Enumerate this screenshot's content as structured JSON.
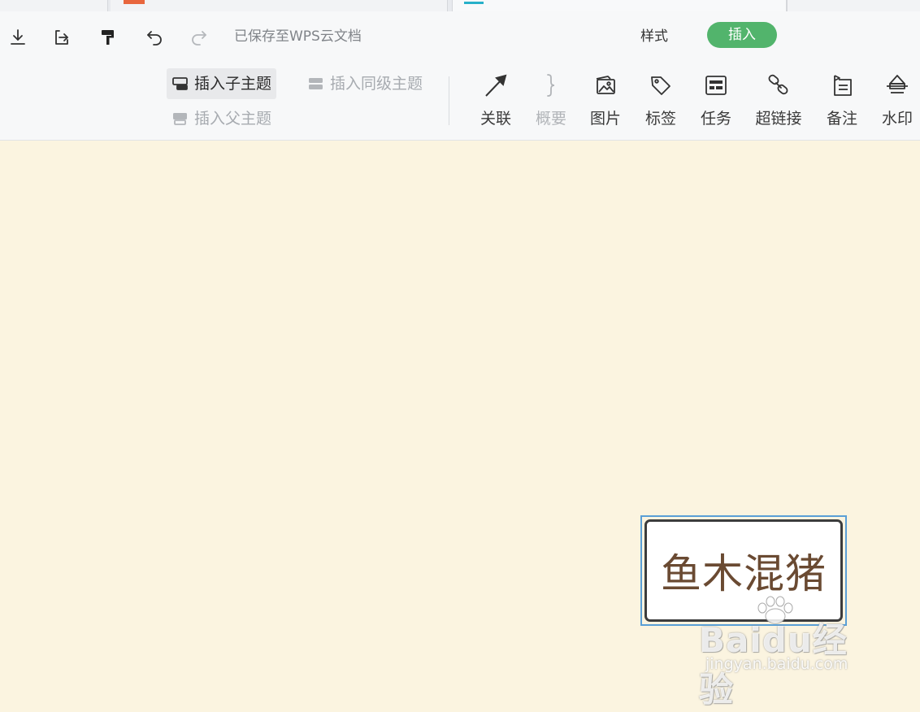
{
  "toolbar": {
    "save_status": "已保存至WPS云文档",
    "tabs": {
      "style": "样式",
      "insert": "插入"
    },
    "insert_group": {
      "child_topic": "插入子主题",
      "sibling_topic": "插入同级主题",
      "parent_topic": "插入父主题"
    },
    "tools": {
      "relation": "关联",
      "summary": "概要",
      "image": "图片",
      "tag": "标签",
      "task": "任务",
      "hyperlink": "超链接",
      "note": "备注",
      "watermark": "水印"
    }
  },
  "canvas": {
    "topic_text": "鱼木混猪"
  },
  "watermark": {
    "brand": "Baidu经验",
    "url": "jingyan.baidu.com"
  },
  "colors": {
    "accent_green": "#52b46c",
    "canvas_bg": "#fbf4e0",
    "selection_blue": "#5a9fd6"
  }
}
